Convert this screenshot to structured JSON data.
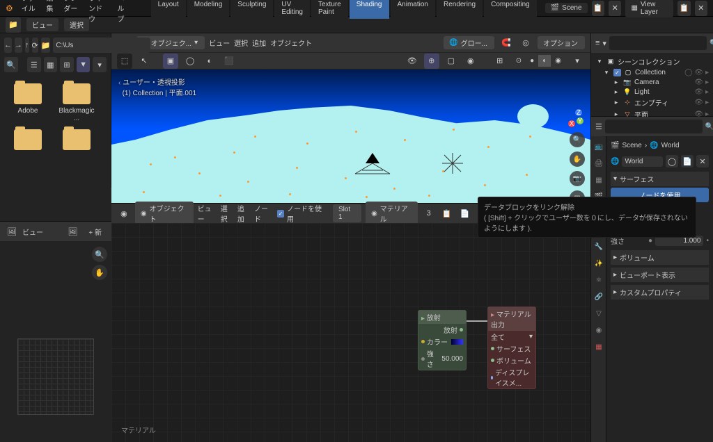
{
  "topbar": {
    "menus": [
      "ファイル",
      "編集",
      "レンダー",
      "ウィンドウ",
      "ヘルプ"
    ],
    "tabs": [
      "Layout",
      "Modeling",
      "Sculpting",
      "UV Editing",
      "Texture Paint",
      "Shading",
      "Animation",
      "Rendering",
      "Compositing"
    ],
    "active_tab": "Shading",
    "scene_label": "Scene",
    "view_layer_label": "View Layer"
  },
  "toolbar2": {
    "view_label": "ビュー",
    "select_label": "選択"
  },
  "file_browser": {
    "path": "C:\\Us",
    "folders": [
      "Adobe",
      "Blackmagic ..."
    ]
  },
  "viewport": {
    "mode": "オブジェク...",
    "menus": [
      "ビュー",
      "選択",
      "追加",
      "オブジェクト"
    ],
    "global_label": "グロー...",
    "options_label": "オプション",
    "info_line1": "ユーザー・透視投影",
    "info_line2": "(1) Collection | 平面.001"
  },
  "node_editor": {
    "mode": "オブジェクト",
    "menus": [
      "ビュー",
      "選択",
      "追加",
      "ノード"
    ],
    "use_nodes_label": "ノードを使用",
    "slot_label": "Slot 1",
    "material_label": "マテリアル",
    "user_count": "3",
    "new_label": "新",
    "bottom_label": "マテリアル",
    "emission_node": {
      "title": "放射",
      "out_socket": "放射",
      "color_label": "カラー",
      "strength_label": "強さ",
      "strength_value": "50.000"
    },
    "output_node": {
      "title": "マテリアル出力",
      "target": "全て",
      "surface": "サーフェス",
      "volume": "ボリューム",
      "displacement": "ディスプレイスメ..."
    }
  },
  "uv_editor": {
    "view_label": "ビュー",
    "new_label": "新"
  },
  "outliner": {
    "scene_collection": "シーンコレクション",
    "collection": "Collection",
    "items": [
      "Camera",
      "Light",
      "エンプティ",
      "平面"
    ]
  },
  "properties": {
    "scene_label": "Scene",
    "world_label": "World",
    "world_datablock": "World",
    "surface_panel": "サーフェス",
    "use_nodes_btn": "ノードを使用",
    "strength_label": "強さ",
    "strength_value": "1.000",
    "volume_panel": "ボリューム",
    "viewport_display_panel": "ビューポート表示",
    "custom_props_panel": "カスタムプロパティ"
  },
  "tooltip": {
    "line1": "データブロックをリンク解除",
    "line2": "( [Shift] + クリックでユーザー数を０にし、データが保存されないようにします )."
  }
}
